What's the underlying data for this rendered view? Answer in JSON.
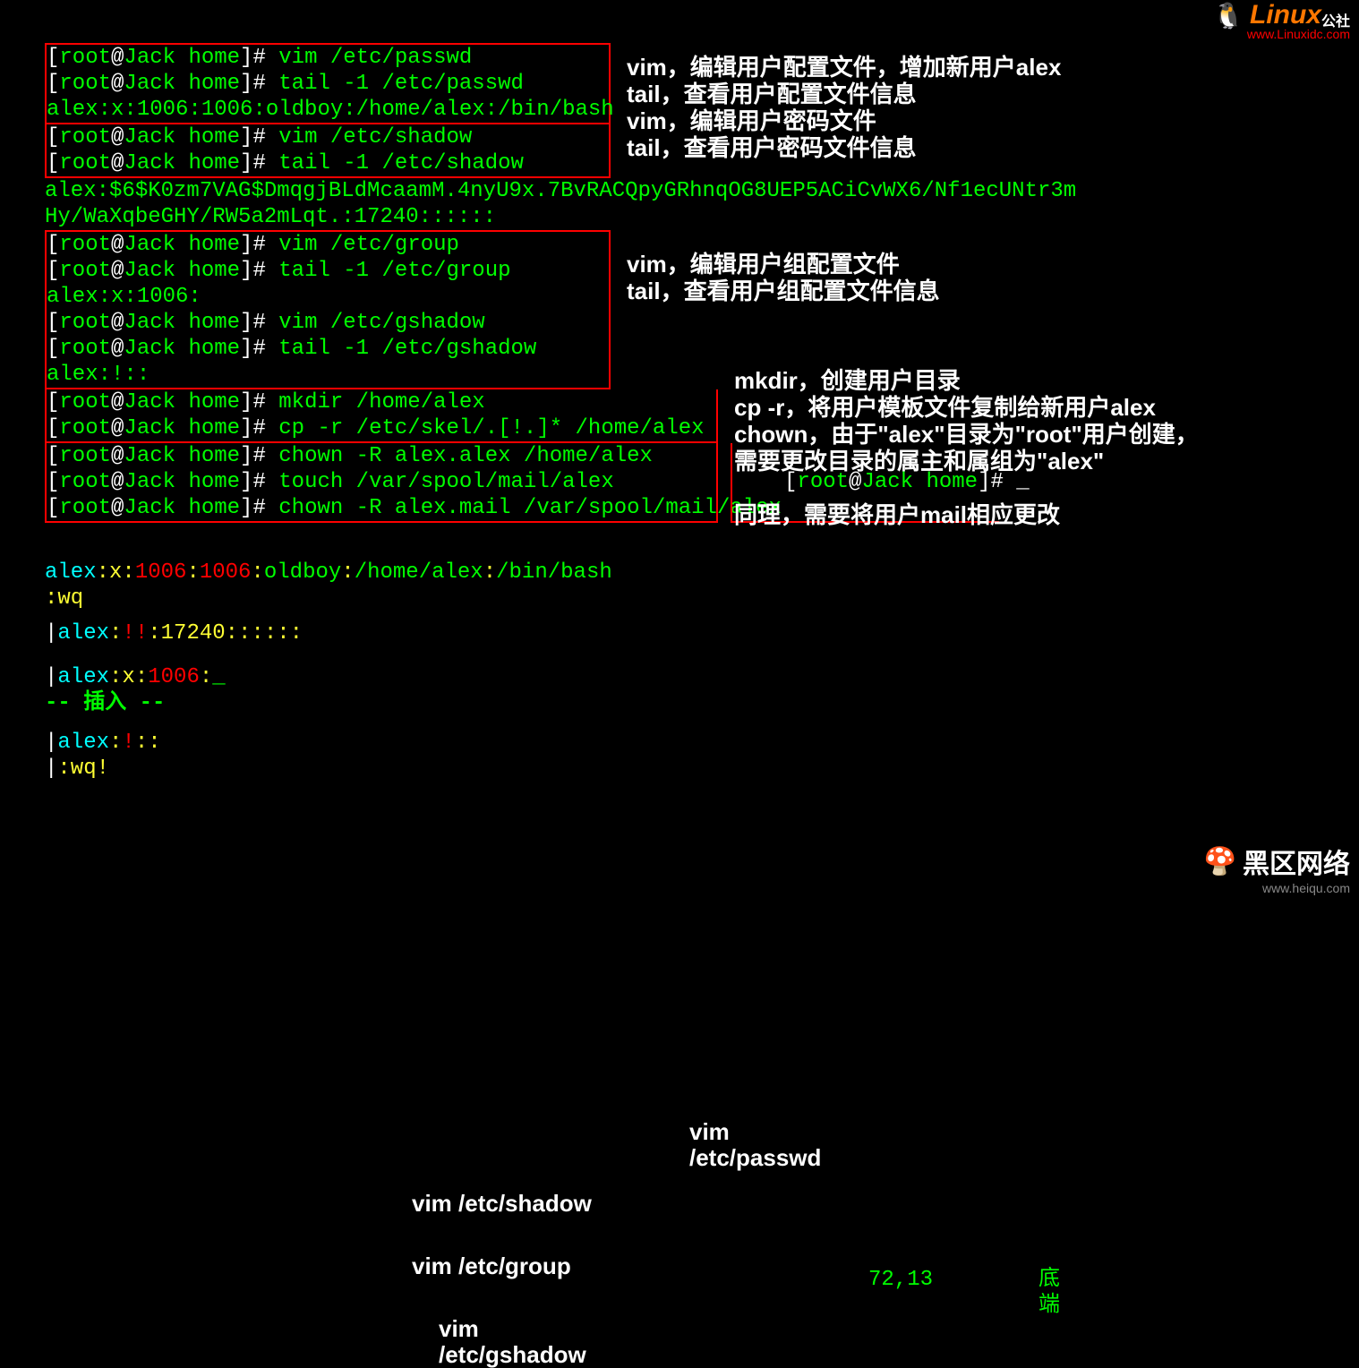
{
  "logo1": {
    "brand": "Linux",
    "suffix": "公社",
    "url": "www.Linuxidc.com"
  },
  "logo2": {
    "brand": "黑区网络",
    "url": "www.heiqu.com"
  },
  "prompt": {
    "user": "root",
    "host": "Jack",
    "path": "home"
  },
  "terminal": {
    "box1": {
      "l1": "vim /etc/passwd",
      "l2": "tail -1 /etc/passwd",
      "l3": "alex:x:1006:1006:oldboy:/home/alex:/bin/bash"
    },
    "hash_out_lines": {
      "l1": "alex:$6$K0zm7VAG$DmqgjBLdMcaamM.4nyU9x.7BvRACQpyGRhnqOG8UEP5ACiCvWX6/Nf1ecUNtr3m",
      "l2": "Hy/WaXqbeGHY/RW5a2mLqt.:17240::::::"
    },
    "box2": {
      "l1": "vim /etc/shadow",
      "l2": "tail -1 /etc/shadow"
    },
    "box3": {
      "l1": "vim /etc/group",
      "l2": "tail -1 /etc/group",
      "l3": "alex:x:1006:",
      "l4": "vim /etc/gshadow",
      "l5": "tail -1 /etc/gshadow",
      "l6": "alex:!::"
    },
    "box4": {
      "l1": "mkdir /home/alex",
      "l2": "cp -r /etc/skel/.[!.]* /home/alex"
    },
    "box5": {
      "l1": "chown -R alex.alex /home/alex",
      "l2": "touch /var/spool/mail/alex",
      "l3": "chown -R alex.mail /var/spool/mail/alex"
    },
    "final_prompt_cursor": "_"
  },
  "annotations": {
    "a1": "vim，编辑用户配置文件，增加新用户alex",
    "a2": "tail，查看用户配置文件信息",
    "a3": "vim，编辑用户密码文件",
    "a4": "tail，查看用户密码文件信息",
    "a5": "vim，编辑用户组配置文件",
    "a6": "tail，查看用户组配置文件信息",
    "a7": "mkdir，创建用户目录",
    "a8": "cp -r，将用户模板文件复制给新用户alex",
    "a9": "chown，由于\"alex\"目录为\"root\"用户创建，",
    "a10": "需要更改目录的属主和属组为\"alex\"",
    "a11": "同理，需要将用户mail相应更改"
  },
  "vim_edits": {
    "passwd_label": "vim /etc/passwd",
    "passwd": "alex:x:1006:1006:oldboy:/home/alex:/bin/bash",
    "wq": ":wq",
    "shadow_label": "vim /etc/shadow",
    "shadow": "alex:!!:17240::::::",
    "group_label": "vim /etc/group",
    "group": "alex:x:1006:",
    "insert": "-- 插入 --",
    "pos": "72,13",
    "bottom": "底端",
    "gshadow_label": "vim /etc/gshadow",
    "gshadow": "alex:!::",
    "wqbang": ":wq!"
  }
}
